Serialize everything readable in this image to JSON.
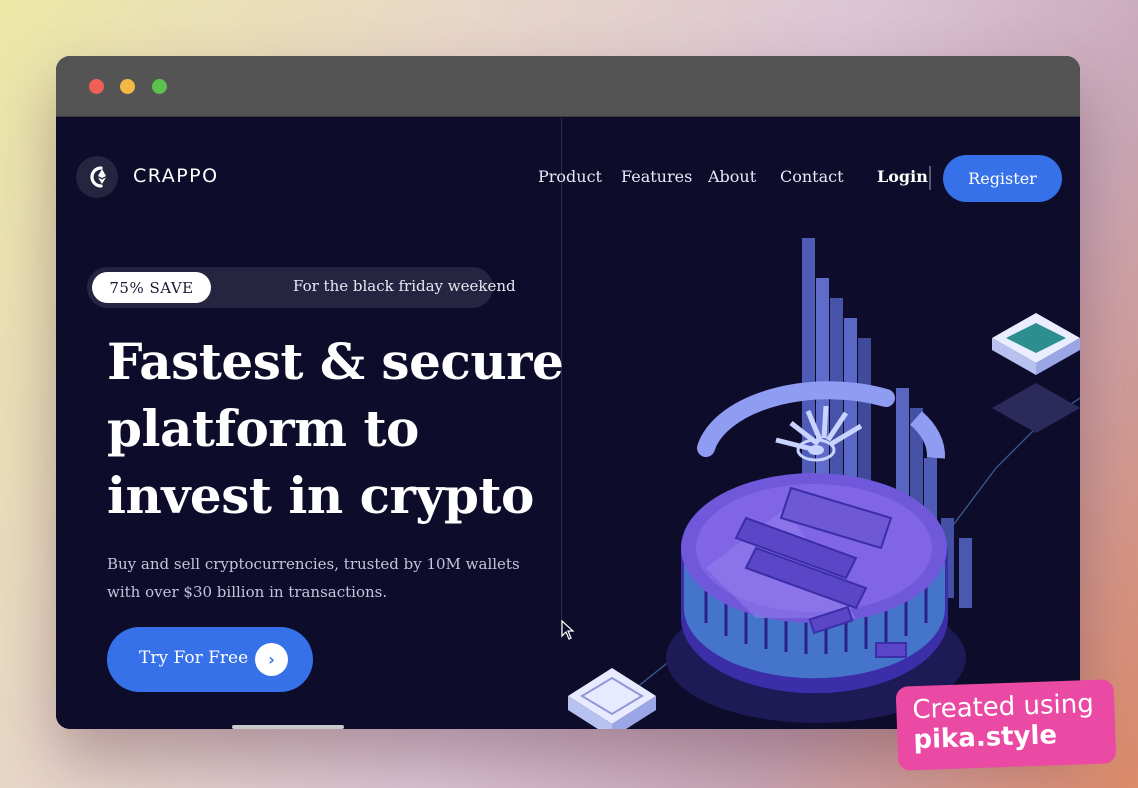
{
  "window": {
    "controls": [
      "close",
      "minimize",
      "maximize"
    ]
  },
  "brand": {
    "name": "CRAPPO",
    "logo_icon": "crappo-logo-icon"
  },
  "nav": {
    "items": [
      "Product",
      "Features",
      "About",
      "Contact"
    ]
  },
  "auth": {
    "login": "Login",
    "register": "Register"
  },
  "promo": {
    "badge": "75% SAVE",
    "text": "For the black friday weekend"
  },
  "hero": {
    "title_lines": [
      "Fastest & secure",
      "platform to",
      "invest in crypto"
    ],
    "subtitle": "Buy and sell cryptocurrencies, trusted by 10M wallets with over $30 billion in transactions.",
    "cta_label": "Try For Free",
    "cta_icon": "chevron-right-icon"
  },
  "illustration": {
    "name": "bitcoin-coin-illustration"
  },
  "watermark": {
    "line1": "Created using",
    "line2": "pika.style"
  },
  "colors": {
    "accent": "#3671e9",
    "background": "#0d0c2a",
    "watermark": "#ea4aa3"
  }
}
